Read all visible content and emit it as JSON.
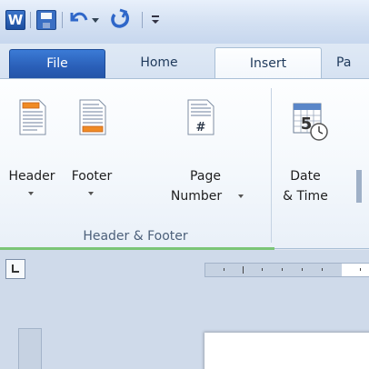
{
  "quick_access": {
    "app_icon_letter": "W",
    "icons": [
      "word-icon",
      "save-icon",
      "undo-icon",
      "undo-dropdown-icon",
      "redo-icon",
      "customize-icon"
    ]
  },
  "tabs": {
    "file": "File",
    "home": "Home",
    "insert": "Insert",
    "page_layout": "Pa"
  },
  "ribbon": {
    "header_footer_group": {
      "label": "Header & Footer",
      "buttons": [
        {
          "line1": "Header",
          "line2": ""
        },
        {
          "line1": "Footer",
          "line2": ""
        },
        {
          "line1": "Page",
          "line2": "Number"
        }
      ]
    },
    "text_group": {
      "buttons": [
        {
          "line1": "Date",
          "line2": "& Time"
        }
      ]
    },
    "page_number_glyph": "#",
    "calendar_day": "5"
  },
  "colors": {
    "file_tab": "#2a5fb8",
    "ribbon_bg": "#f4f8fc",
    "accent_green": "#7cc576",
    "accent_orange": "#f08a24"
  }
}
